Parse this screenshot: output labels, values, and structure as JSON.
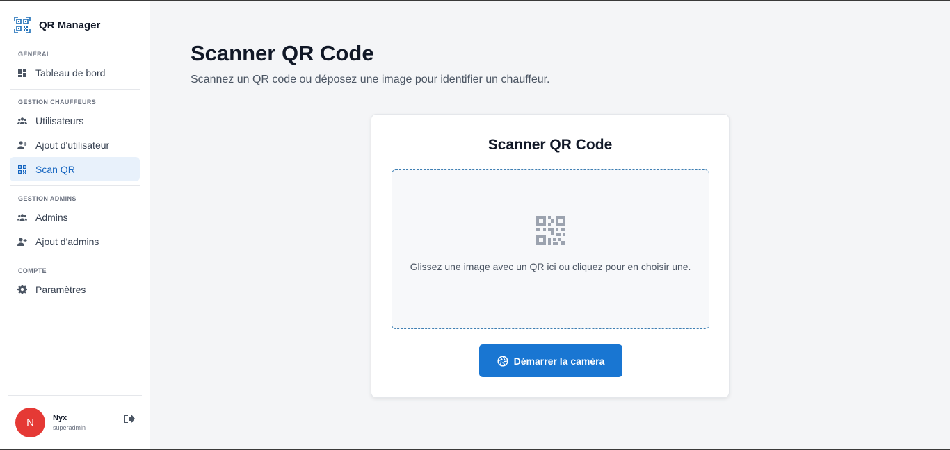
{
  "app": {
    "name": "QR Manager"
  },
  "sidebar": {
    "sections": [
      {
        "label": "GÉNÉRAL",
        "items": [
          {
            "label": "Tableau de bord",
            "icon": "dashboard-icon"
          }
        ]
      },
      {
        "label": "GESTION CHAUFFEURS",
        "items": [
          {
            "label": "Utilisateurs",
            "icon": "users-icon"
          },
          {
            "label": "Ajout d'utilisateur",
            "icon": "user-plus-icon"
          },
          {
            "label": "Scan QR",
            "icon": "qr-icon",
            "active": true
          }
        ]
      },
      {
        "label": "GESTION ADMINS",
        "items": [
          {
            "label": "Admins",
            "icon": "users-icon"
          },
          {
            "label": "Ajout d'admins",
            "icon": "user-plus-icon"
          }
        ]
      },
      {
        "label": "COMPTE",
        "items": [
          {
            "label": "Paramètres",
            "icon": "gear-icon"
          }
        ]
      }
    ]
  },
  "user": {
    "initial": "N",
    "name": "Nyx",
    "role": "superadmin"
  },
  "page": {
    "title": "Scanner QR Code",
    "subtitle": "Scannez un QR code ou déposez une image pour identifier un chauffeur."
  },
  "card": {
    "title": "Scanner QR Code",
    "dropzone_text": "Glissez une image avec un QR ici ou cliquez pour en choisir une.",
    "camera_button": "Démarrer la caméra"
  },
  "colors": {
    "accent": "#1976d2",
    "active_bg": "#e8f1fb",
    "avatar": "#e53935"
  }
}
